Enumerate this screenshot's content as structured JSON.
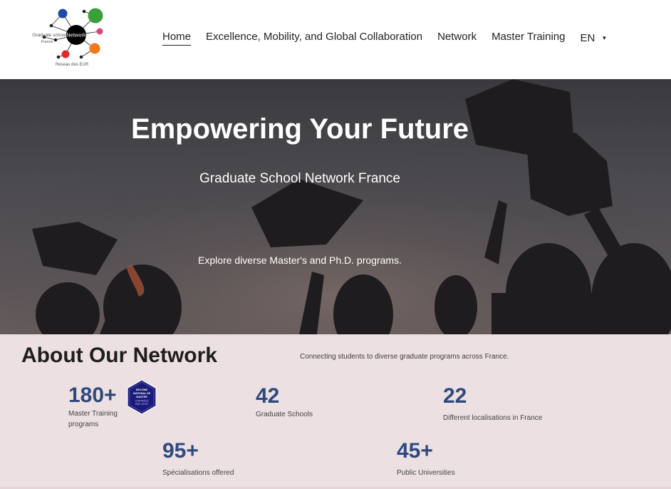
{
  "logo": {
    "main_text": "Network",
    "side_text": "Graduate school",
    "country": "France",
    "caption": "Réseau des EUR"
  },
  "nav": {
    "items": [
      {
        "label": "Home",
        "active": true
      },
      {
        "label": "Excellence, Mobility, and Global Collaboration",
        "active": false
      },
      {
        "label": "Network",
        "active": false
      },
      {
        "label": "Master Training",
        "active": false
      }
    ],
    "language": "EN"
  },
  "hero": {
    "title": "Empowering Your Future",
    "subtitle": "Graduate School Network France",
    "description": "Explore diverse Master's and Ph.D. programs."
  },
  "about": {
    "title": "About Our Network",
    "tagline": "Connecting students to diverse graduate programs across France.",
    "stats": [
      {
        "value": "180+",
        "label": "Master Training programs"
      },
      {
        "value": "42",
        "label": "Graduate Schools"
      },
      {
        "value": "22",
        "label": "Different localisations in France"
      },
      {
        "value": "95+",
        "label": "Spécialisations offered"
      },
      {
        "value": "45+",
        "label": "Public Universities"
      }
    ],
    "badge": {
      "line1": "DIPLÔME",
      "line2": "NATIONAL DE",
      "line3": "MASTER",
      "line4": "CONTRÔLÉ",
      "line5": "PAR L'ÉTAT"
    }
  },
  "colors": {
    "accent": "#2e4a7d",
    "about_bg": "#ede0e2",
    "badge_bg": "#1a1a7a"
  },
  "icons": {
    "language_caret": "caret-down-icon"
  }
}
